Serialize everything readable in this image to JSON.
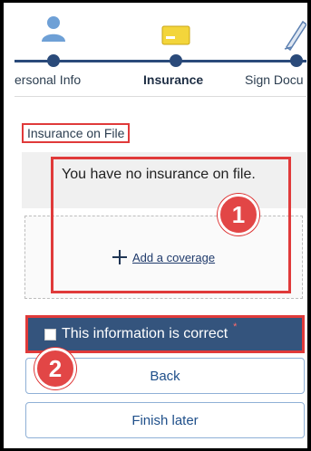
{
  "stepper": {
    "steps": [
      {
        "label": "ersonal Info",
        "icon": "person-icon",
        "state": "done"
      },
      {
        "label": "Insurance",
        "icon": "id-card-icon",
        "state": "current"
      },
      {
        "label": "Sign Docu",
        "icon": "pen-icon",
        "state": "todo"
      }
    ]
  },
  "insurance": {
    "section_title": "Insurance on File",
    "empty_message": "You have no insurance on file.",
    "add_coverage_label": "Add a coverage"
  },
  "confirm": {
    "label": "This information is correct",
    "required_marker": "*"
  },
  "buttons": {
    "back_label": "Back",
    "finish_later_label": "Finish later"
  },
  "annotations": {
    "badge1": "1",
    "badge2": "2"
  },
  "colors": {
    "primary": "#34547d",
    "highlight": "#e03a3a",
    "link": "#1f3a6b",
    "button_text": "#1f4f8a"
  }
}
